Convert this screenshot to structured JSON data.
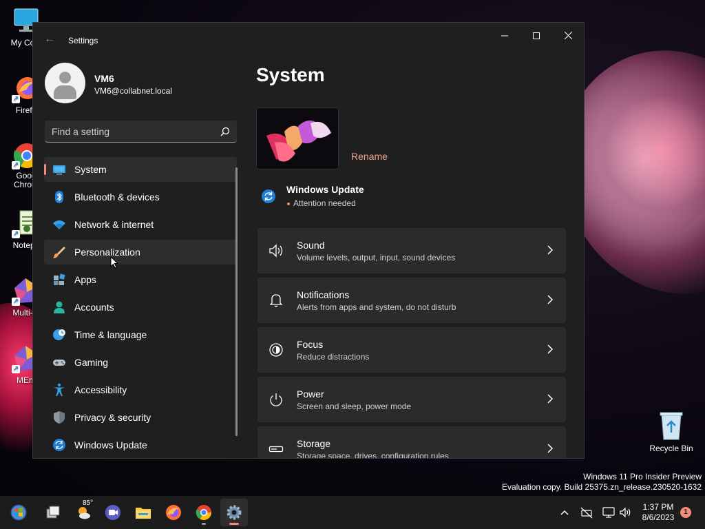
{
  "desktop": {
    "icons": [
      {
        "label": "My Com"
      },
      {
        "label": "Firefo"
      },
      {
        "label": "Goog\nChrom"
      },
      {
        "label": "Notepa"
      },
      {
        "label": "Multi-M"
      },
      {
        "label": "MEm"
      }
    ],
    "recycle_bin": "Recycle Bin",
    "watermark": {
      "line1": "Windows 11 Pro Insider Preview",
      "line2": "Evaluation copy. Build 25375.zn_release.230520-1632"
    }
  },
  "window": {
    "title": "Settings",
    "back_icon": "back-arrow-icon",
    "controls": [
      "minimize",
      "maximize",
      "close"
    ]
  },
  "profile": {
    "name": "VM6",
    "email": "VM6@collabnet.local"
  },
  "search": {
    "placeholder": "Find a setting"
  },
  "sidebar": {
    "items": [
      {
        "label": "System",
        "icon": "system-display-icon",
        "selected": true
      },
      {
        "label": "Bluetooth & devices",
        "icon": "bluetooth-icon"
      },
      {
        "label": "Network & internet",
        "icon": "wifi-icon"
      },
      {
        "label": "Personalization",
        "icon": "brush-icon"
      },
      {
        "label": "Apps",
        "icon": "apps-icon"
      },
      {
        "label": "Accounts",
        "icon": "accounts-icon"
      },
      {
        "label": "Time & language",
        "icon": "globe-clock-icon"
      },
      {
        "label": "Gaming",
        "icon": "gamepad-icon"
      },
      {
        "label": "Accessibility",
        "icon": "accessibility-icon"
      },
      {
        "label": "Privacy & security",
        "icon": "shield-icon"
      },
      {
        "label": "Windows Update",
        "icon": "update-icon"
      }
    ]
  },
  "main": {
    "title": "System",
    "rename_label": "Rename",
    "windows_update": {
      "title": "Windows Update",
      "status": "Attention needed"
    },
    "cards": [
      {
        "title": "Sound",
        "subtitle": "Volume levels, output, input, sound devices",
        "icon": "speaker-icon"
      },
      {
        "title": "Notifications",
        "subtitle": "Alerts from apps and system, do not disturb",
        "icon": "bell-icon"
      },
      {
        "title": "Focus",
        "subtitle": "Reduce distractions",
        "icon": "focus-icon"
      },
      {
        "title": "Power",
        "subtitle": "Screen and sleep, power mode",
        "icon": "power-icon"
      },
      {
        "title": "Storage",
        "subtitle": "Storage space, drives, configuration rules",
        "icon": "storage-icon"
      }
    ]
  },
  "taskbar": {
    "weather_temp": "85°",
    "time": "1:37 PM",
    "date": "8/6/2023",
    "notification_count": "1"
  },
  "colors": {
    "accent": "#f38a7a",
    "window_bg": "#1f1f1f",
    "card_bg": "#2b2b2b",
    "taskbar_bg": "#1c1c1c"
  }
}
